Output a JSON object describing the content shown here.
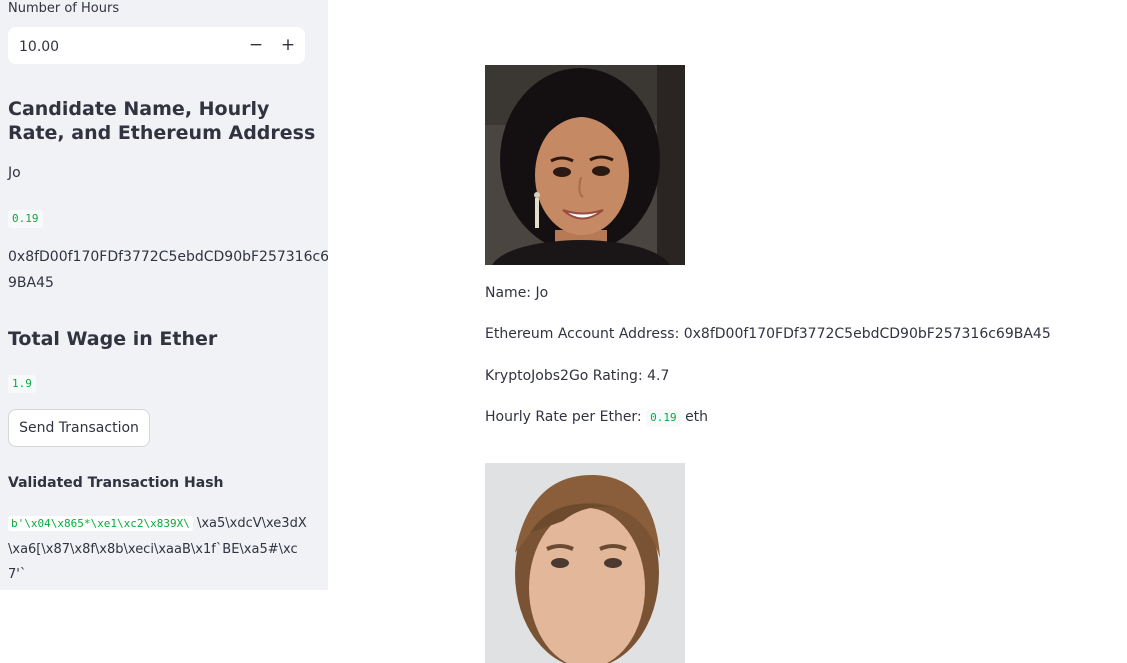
{
  "sidebar": {
    "hours_label": "Number of Hours",
    "hours_value": "10.00",
    "minus_symbol": "−",
    "plus_symbol": "+",
    "candidate_heading": "Candidate Name, Hourly Rate, and Ethereum Address",
    "candidate_name": "Jo",
    "hourly_rate": "0.19",
    "address_line1": "0x8fD00f170FDf3772C5ebdCD90bF257316c6",
    "address_line2": "9BA45",
    "total_wage_heading": "Total Wage in Ether",
    "total_wage": "1.9",
    "send_button_label": "Send Transaction",
    "hash_heading": "Validated Transaction Hash",
    "hash_code": "b'\\x04\\x865*\\xe1\\xc2\\x839X\\",
    "hash_rest": "\\xa5\\xdcV\\xe3dX\\xa6[\\x87\\x8f\\x8b\\xeci\\xaaB\\x1f`BE\\xa5#\\xc7'`"
  },
  "candidates": [
    {
      "name_line": "Name: Jo",
      "address_line": "Ethereum Account Address: 0x8fD00f170FDf3772C5ebdCD90bF257316c69BA45",
      "rating_line": "KryptoJobs2Go Rating: 4.7",
      "rate_prefix": "Hourly Rate per Ether: ",
      "rate_value": "0.19",
      "rate_suffix": "eth"
    },
    {}
  ],
  "colors": {
    "sidebar_bg": "#f0f2f6",
    "code_green": "#09ab3b",
    "text": "#31333f"
  },
  "icons": [
    "minus-icon",
    "plus-icon"
  ]
}
